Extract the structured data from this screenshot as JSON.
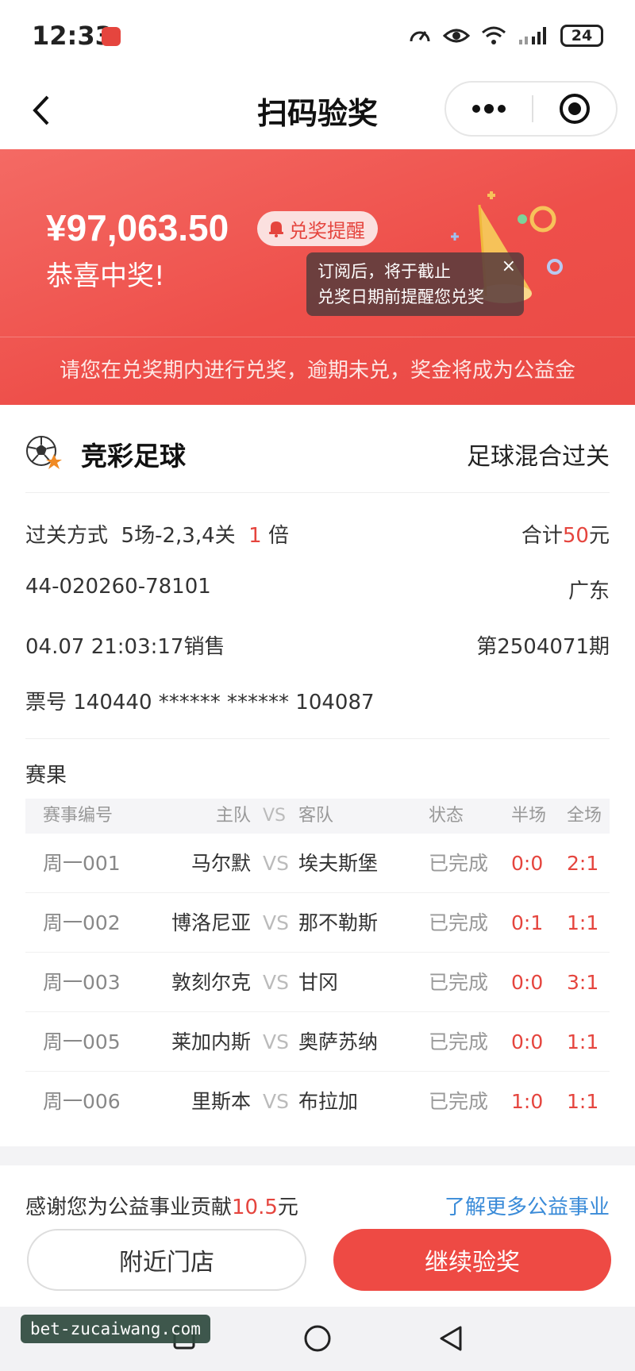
{
  "status_bar": {
    "time": "12:33",
    "battery": "24"
  },
  "nav": {
    "title": "扫码验奖",
    "more_label": "•••"
  },
  "banner": {
    "amount": "¥97,063.50",
    "remind_label": "兑奖提醒",
    "congrats": "恭喜中奖!",
    "tooltip_line1": "订阅后，将于截止",
    "tooltip_line2": "兑奖日期前提醒您兑奖",
    "tooltip_close": "×",
    "note": "请您在兑奖期内进行兑奖，逾期未兑，奖金将成为公益金"
  },
  "ticket": {
    "lottery_name": "竞彩足球",
    "lottery_type": "足球混合过关",
    "pass_label": "过关方式",
    "pass_value": "5场-2,3,4关",
    "multiple": "1",
    "multiple_unit": "倍",
    "total_label": "合计",
    "total_amount": "50",
    "total_unit": "元",
    "serial": "44-020260-78101",
    "region": "广东",
    "sale_time": "04.07 21:03:17销售",
    "period": "第2504071期",
    "ticket_no": "票号 140440 ****** ****** 104087"
  },
  "results": {
    "title": "赛果",
    "headers": {
      "no": "赛事编号",
      "home": "主队",
      "vs": "VS",
      "away": "客队",
      "status": "状态",
      "half": "半场",
      "full": "全场"
    },
    "rows": [
      {
        "no": "周一001",
        "home": "马尔默",
        "vs": "VS",
        "away": "埃夫斯堡",
        "status": "已完成",
        "half": "0:0",
        "full": "2:1"
      },
      {
        "no": "周一002",
        "home": "博洛尼亚",
        "vs": "VS",
        "away": "那不勒斯",
        "status": "已完成",
        "half": "0:1",
        "full": "1:1"
      },
      {
        "no": "周一003",
        "home": "敦刻尔克",
        "vs": "VS",
        "away": "甘冈",
        "status": "已完成",
        "half": "0:0",
        "full": "3:1"
      },
      {
        "no": "周一005",
        "home": "莱加内斯",
        "vs": "VS",
        "away": "奥萨苏纳",
        "status": "已完成",
        "half": "0:0",
        "full": "1:1"
      },
      {
        "no": "周一006",
        "home": "里斯本",
        "vs": "VS",
        "away": "布拉加",
        "status": "已完成",
        "half": "1:0",
        "full": "1:1"
      }
    ]
  },
  "footer": {
    "charity_prefix": "感谢您为公益事业贡献",
    "charity_amount": "10.5",
    "charity_unit": "元",
    "charity_link": "了解更多公益事业",
    "nearby_label": "附近门店",
    "continue_label": "继续验奖"
  },
  "watermark": "bet-zucaiwang.com",
  "colors": {
    "accent": "#ee4a44",
    "link": "#3a8bd8",
    "score": "#e5453e"
  }
}
